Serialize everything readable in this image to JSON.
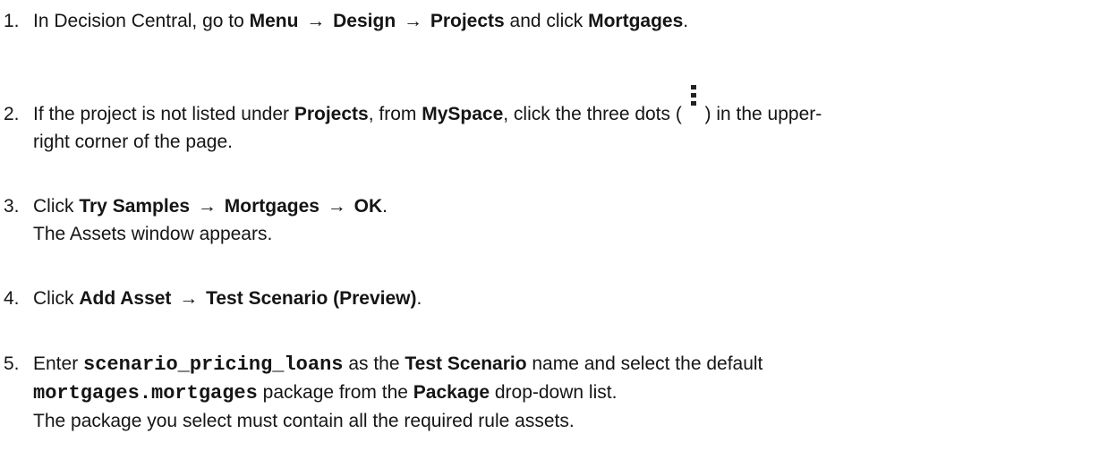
{
  "steps": [
    {
      "number": "1.",
      "t1": "In Decision Central, go to ",
      "b1": "Menu",
      "a1": "→",
      "b2": "Design",
      "a2": "→",
      "b3": "Projects",
      "t2": " and click ",
      "b4": "Mortgages",
      "t3": "."
    },
    {
      "number": "2.",
      "t1": "If the project is not listed under ",
      "b1": "Projects",
      "t2": ", from ",
      "b2": "MySpace",
      "t3": ", click the three dots ( ",
      "icon": "kebab-menu-icon",
      "t4": " ) in the upper-",
      "t5": "right corner of the page."
    },
    {
      "number": "3.",
      "t1": "Click ",
      "b1": "Try Samples",
      "a1": "→",
      "b2": "Mortgages",
      "a2": "→",
      "b3": "OK",
      "t2": ".",
      "line2": "The Assets window appears."
    },
    {
      "number": "4.",
      "t1": "Click ",
      "b1": "Add Asset",
      "a1": "→",
      "b2": "Test Scenario (Preview)",
      "t2": "."
    },
    {
      "number": "5.",
      "t1": "Enter ",
      "c1": "scenario_pricing_loans",
      "t2": " as the ",
      "b1": "Test Scenario",
      "t3": " name and select the default",
      "c2": "mortgages.mortgages",
      "t4": " package from the ",
      "b2": "Package",
      "t5": " drop-down list.",
      "line3": "The package you select must contain all the required rule assets."
    }
  ]
}
